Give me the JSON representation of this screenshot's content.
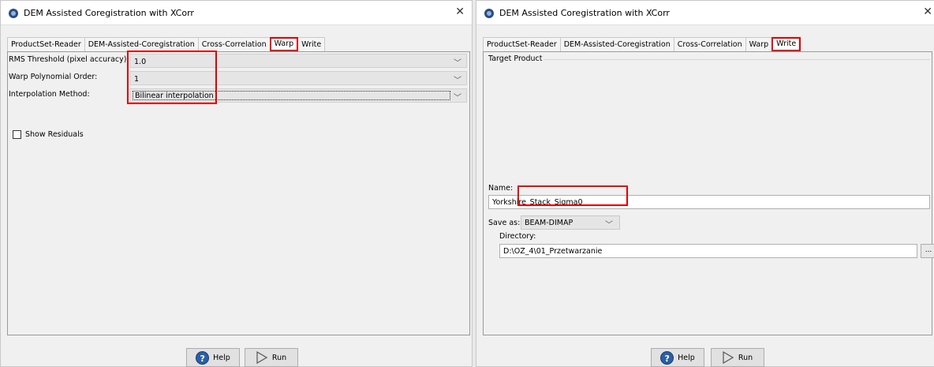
{
  "windows": [
    {
      "title": "DEM Assisted Coregistration with XCorr",
      "tabs": [
        "ProductSet-Reader",
        "DEM-Assisted-Coregistration",
        "Cross-Correlation",
        "Warp",
        "Write"
      ],
      "selected_tab": "Warp",
      "fields": {
        "rms_label": "RMS Threshold (pixel accuracy):",
        "rms_value": "1.0",
        "order_label": "Warp Polynomial Order:",
        "order_value": "1",
        "interp_label": "Interpolation Method:",
        "interp_value": "Bilinear interpolation",
        "residuals_label": "Show Residuals",
        "residuals_checked": false
      },
      "buttons": {
        "help": "Help",
        "run": "Run"
      }
    },
    {
      "title": "DEM Assisted Coregistration with XCorr",
      "tabs": [
        "ProductSet-Reader",
        "DEM-Assisted-Coregistration",
        "Cross-Correlation",
        "Warp",
        "Write"
      ],
      "selected_tab": "Write",
      "fields": {
        "group_title": "Target Product",
        "name_label": "Name:",
        "name_value": "Yorkshire_Stack_Sigma0",
        "saveas_label": "Save as:",
        "saveas_value": "BEAM-DIMAP",
        "directory_label": "Directory:",
        "directory_value": "D:\\OZ_4\\01_Przetwarzanie",
        "browse_label": "..."
      },
      "buttons": {
        "help": "Help",
        "run": "Run"
      }
    }
  ],
  "colors": {
    "highlight": "#e00000",
    "panel_bg": "#f0f0f0",
    "help_blue": "#2a5fa8"
  },
  "icons": {
    "app": "dem-coregistration-app-icon",
    "close": "close-icon",
    "help": "help-icon",
    "run": "run-icon"
  }
}
